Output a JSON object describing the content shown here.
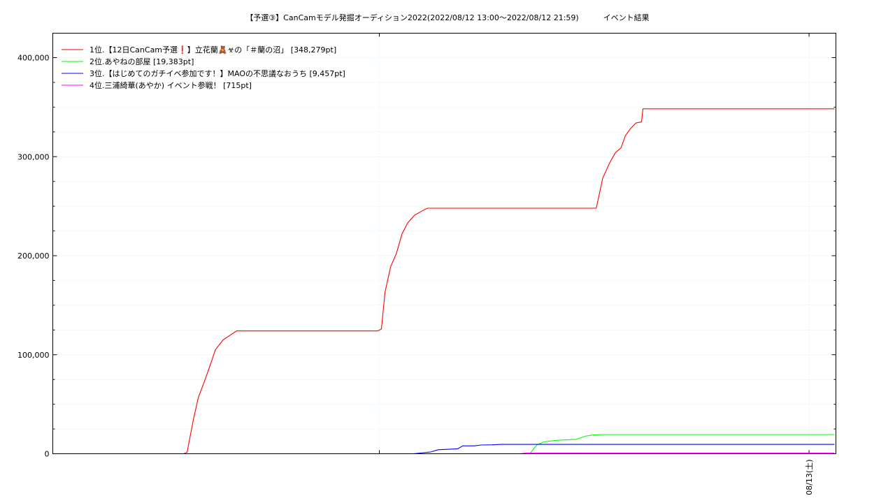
{
  "chart_data": {
    "type": "line",
    "title": "【予選③】CanCamモデル発掘オーディション2022(2022/08/12 13:00～2022/08/12 21:59)          イベント結果",
    "xlabel": "",
    "ylabel": "",
    "x_unit": "hours since 2022/08/12 13:00",
    "xlim": [
      -1.1,
      9.98
    ],
    "ylim": [
      0,
      400000
    ],
    "y_ticks": [
      {
        "value": 0,
        "label": "0"
      },
      {
        "value": 100000,
        "label": "100,000"
      },
      {
        "value": 200000,
        "label": "200,000"
      },
      {
        "value": 300000,
        "label": "300,000"
      },
      {
        "value": 400000,
        "label": "400,000"
      }
    ],
    "x_ticks": [
      {
        "value": 9.6,
        "label": "08/13(土)"
      }
    ],
    "x_grid": [
      3.52,
      9.6
    ],
    "grid": true,
    "legend_position": "top-left",
    "series": [
      {
        "name": "1位.【12日CanCam予選❗️】立花蘭🧸☣︎の「＃蘭の沼」 [348,279pt]",
        "color": "#ff0000",
        "x": [
          0.75,
          0.8,
          0.89,
          0.96,
          1.04,
          1.12,
          1.2,
          1.31,
          1.5,
          1.8,
          3.5,
          3.55,
          3.6,
          3.68,
          3.76,
          3.84,
          3.92,
          4.02,
          4.12,
          4.2,
          4.27,
          4.35,
          4.6,
          5.0,
          5.5,
          6.0,
          6.4,
          6.59,
          6.68,
          6.78,
          6.86,
          6.94,
          7.0,
          7.07,
          7.15,
          7.23,
          7.25,
          7.5,
          8.0,
          8.5,
          9.0,
          9.5,
          9.96
        ],
        "values": [
          0,
          1500,
          35000,
          57000,
          72000,
          88000,
          105000,
          115000,
          124000,
          124000,
          124000,
          126000,
          163000,
          189000,
          202000,
          222000,
          233000,
          241000,
          245000,
          248000,
          248000,
          248000,
          248000,
          248000,
          248000,
          248000,
          248000,
          248000,
          278000,
          294000,
          304000,
          309000,
          321000,
          328000,
          334000,
          335000,
          348279,
          348279,
          348279,
          348279,
          348279,
          348279,
          348279
        ]
      },
      {
        "name": "2位.あやねの部屋 [19,383pt]",
        "color": "#00ff00",
        "x": [
          5.5,
          5.65,
          5.75,
          5.85,
          6.0,
          6.3,
          6.45,
          6.55,
          6.7,
          7.5,
          8.5,
          9.96
        ],
        "values": [
          0,
          0,
          9000,
          12000,
          13500,
          14500,
          18000,
          19000,
          19383,
          19383,
          19383,
          19383
        ],
        "marks_start": 0
      },
      {
        "name": "3位.【はじめてのガチイベ参加です！】MAOの不思議なおうち [9,457pt]",
        "color": "#0000ff",
        "x": [
          3.52,
          4.0,
          4.25,
          4.35,
          4.5,
          4.63,
          4.7,
          4.86,
          4.96,
          5.12,
          5.25,
          6.0,
          7.0,
          8.0,
          9.0,
          9.96
        ],
        "values": [
          0,
          0,
          1800,
          4000,
          4500,
          5000,
          8000,
          8000,
          8800,
          9000,
          9457,
          9457,
          9457,
          9457,
          9457,
          9457
        ]
      },
      {
        "name": "4位.三浦綺華(あやか) イベント参戦！ [715pt]",
        "color": "#ff00ff",
        "x": [
          3.52,
          5.5,
          5.6,
          6.0,
          7.0,
          8.0,
          9.0,
          9.96
        ],
        "values": [
          0,
          0,
          715,
          715,
          715,
          715,
          715,
          715
        ]
      }
    ]
  }
}
